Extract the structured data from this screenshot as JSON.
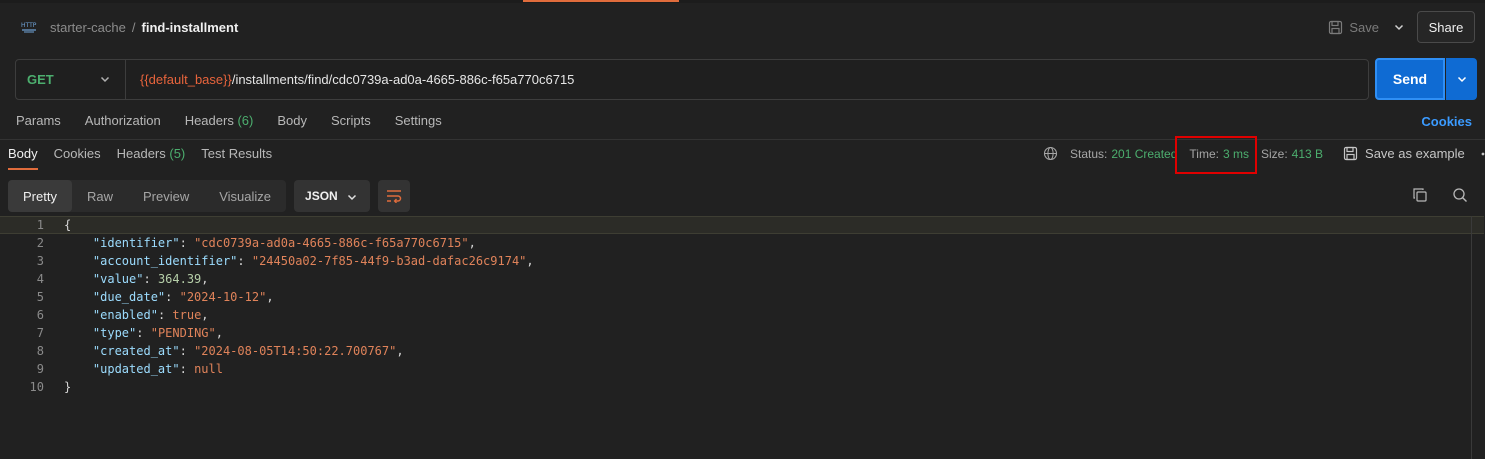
{
  "breadcrumb": {
    "parent": "starter-cache",
    "separator": "/",
    "current": "find-installment"
  },
  "toolbar": {
    "save_label": "Save",
    "share_label": "Share"
  },
  "request": {
    "method": "GET",
    "url_variable": "{{default_base}}",
    "url_path": "/installments/find/cdc0739a-ad0a-4665-886c-f65a770c6715",
    "send_label": "Send"
  },
  "request_tabs": {
    "params": "Params",
    "authorization": "Authorization",
    "headers": "Headers",
    "headers_count": "(6)",
    "body": "Body",
    "scripts": "Scripts",
    "settings": "Settings",
    "cookies": "Cookies"
  },
  "response_tabs": {
    "body": "Body",
    "cookies": "Cookies",
    "headers": "Headers",
    "headers_count": "(5)",
    "test_results": "Test Results"
  },
  "response_status": {
    "status_label": "Status:",
    "status_value": "201 Created",
    "time_label": "Time:",
    "time_value": "3 ms",
    "size_label": "Size:",
    "size_value": "413 B",
    "save_example": "Save as example"
  },
  "view_modes": {
    "pretty": "Pretty",
    "raw": "Raw",
    "preview": "Preview",
    "visualize": "Visualize",
    "format": "JSON"
  },
  "code_lines": [
    {
      "n": "1",
      "text": "{"
    },
    {
      "n": "2",
      "key": "\"identifier\"",
      "sep": ": ",
      "val": "\"cdc0739a-ad0a-4665-886c-f65a770c6715\"",
      "vt": "s",
      "tail": ","
    },
    {
      "n": "3",
      "key": "\"account_identifier\"",
      "sep": ": ",
      "val": "\"24450a02-7f85-44f9-b3ad-dafac26c9174\"",
      "vt": "s",
      "tail": ","
    },
    {
      "n": "4",
      "key": "\"value\"",
      "sep": ": ",
      "val": "364.39",
      "vt": "n",
      "tail": ","
    },
    {
      "n": "5",
      "key": "\"due_date\"",
      "sep": ": ",
      "val": "\"2024-10-12\"",
      "vt": "s",
      "tail": ","
    },
    {
      "n": "6",
      "key": "\"enabled\"",
      "sep": ": ",
      "val": "true",
      "vt": "b",
      "tail": ","
    },
    {
      "n": "7",
      "key": "\"type\"",
      "sep": ": ",
      "val": "\"PENDING\"",
      "vt": "s",
      "tail": ","
    },
    {
      "n": "8",
      "key": "\"created_at\"",
      "sep": ": ",
      "val": "\"2024-08-05T14:50:22.700767\"",
      "vt": "s",
      "tail": ","
    },
    {
      "n": "9",
      "key": "\"updated_at\"",
      "sep": ": ",
      "val": "null",
      "vt": "b",
      "tail": ""
    },
    {
      "n": "10",
      "text": "}"
    }
  ],
  "colors": {
    "accent": "#e06c3c",
    "send": "#0f6bd3",
    "green": "#4cae6e",
    "link": "#3b9bff",
    "highlight": "#e00000"
  },
  "icons": [
    "http-icon",
    "save-icon",
    "chevron-down-icon",
    "globe-icon",
    "save-example-icon",
    "more-icon",
    "wrap-icon",
    "copy-icon",
    "search-icon"
  ]
}
